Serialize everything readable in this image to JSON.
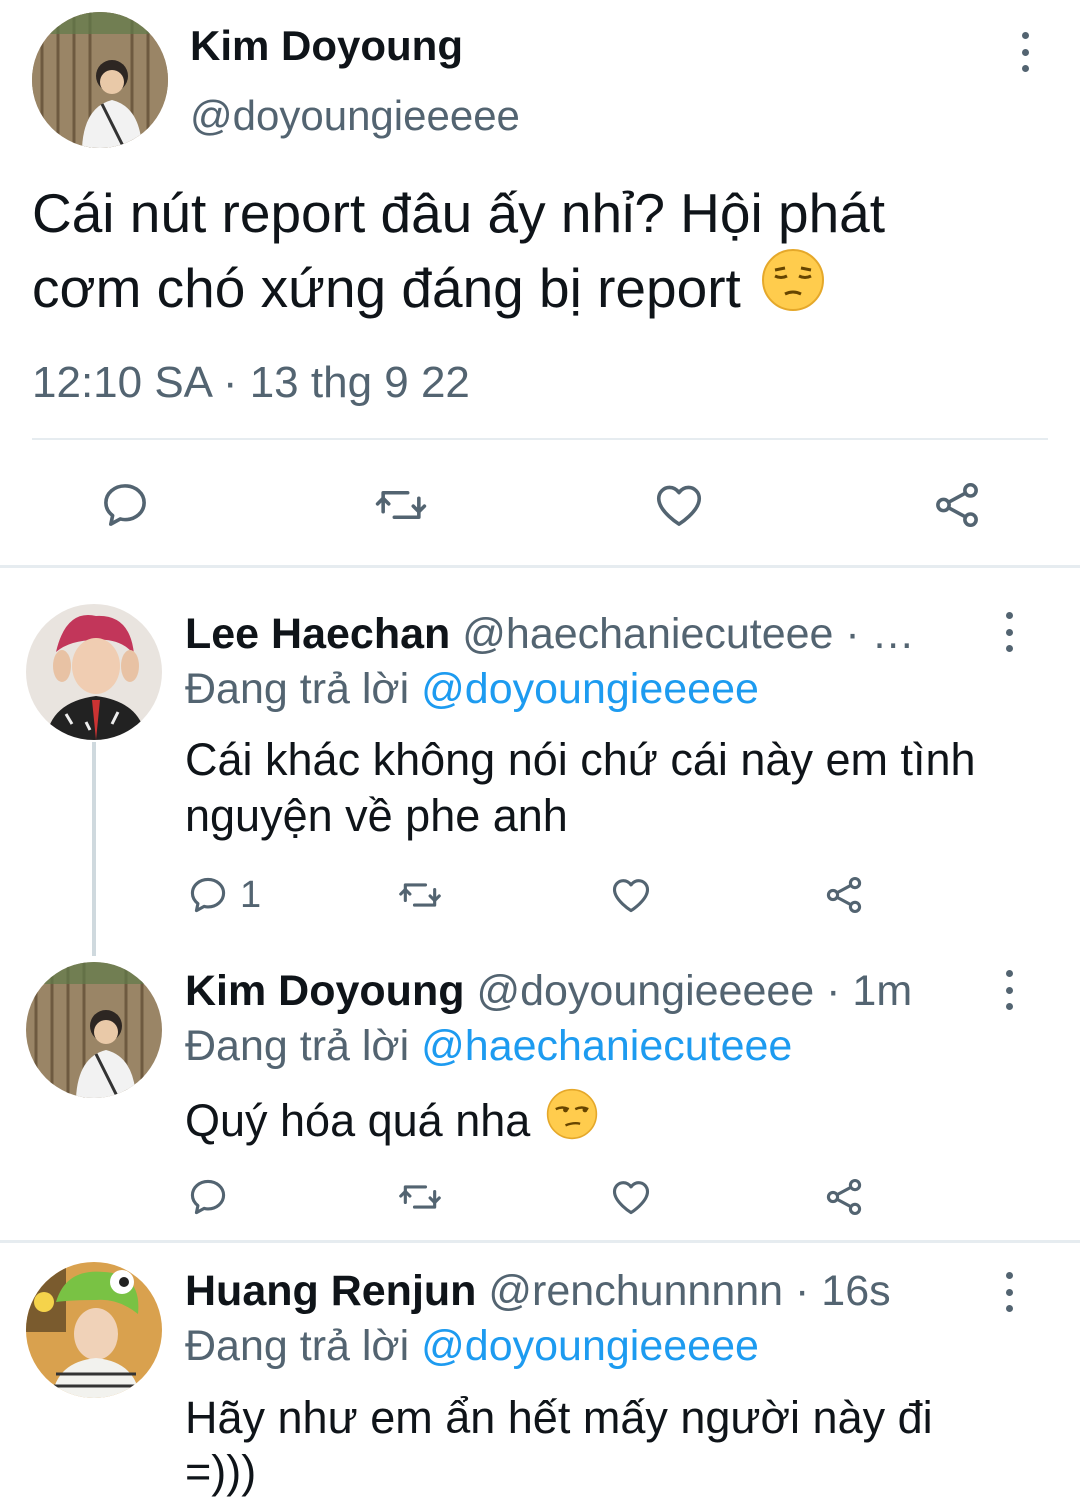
{
  "main_tweet": {
    "author_name": "Kim Doyoung",
    "handle": "@doyoungieeeee",
    "text_line1": "Cái nút report đâu ấy nhỉ? Hội phát",
    "text_line2": "cơm chó xứng đáng bị report",
    "emoji": "pensive-face",
    "timestamp": "12:10 SA · 13 thg 9 22"
  },
  "replies": [
    {
      "author_name": "Lee Haechan",
      "handle_time": "@haechaniecuteee · …",
      "replying_prefix": "Đang trả lời",
      "replying_to": "@doyoungieeeee",
      "text_line1": "Cái khác không nói chứ cái này em tình",
      "text_line2": "nguyện về phe anh",
      "reply_count": "1"
    },
    {
      "author_name": "Kim Doyoung",
      "handle_time": "@doyoungieeeee · 1m",
      "replying_prefix": "Đang trả lời",
      "replying_to": "@haechaniecuteee",
      "text_line1": "Quý hóa quá nha",
      "emoji": "unamused-face"
    },
    {
      "author_name": "Huang Renjun",
      "handle_time": "@renchunnnnn · 16s",
      "replying_prefix": "Đang trả lời",
      "replying_to": "@doyoungieeeee",
      "text_line1": "Hãy như em ẩn hết mấy người này đi",
      "text_line2": "=)))"
    }
  ],
  "colors": {
    "text": "#0f1419",
    "secondary": "#536471",
    "accent": "#1d9bf0",
    "divider": "#e6ecf0"
  },
  "icons": [
    "reply-icon",
    "retweet-icon",
    "like-icon",
    "share-icon",
    "more-icon"
  ]
}
